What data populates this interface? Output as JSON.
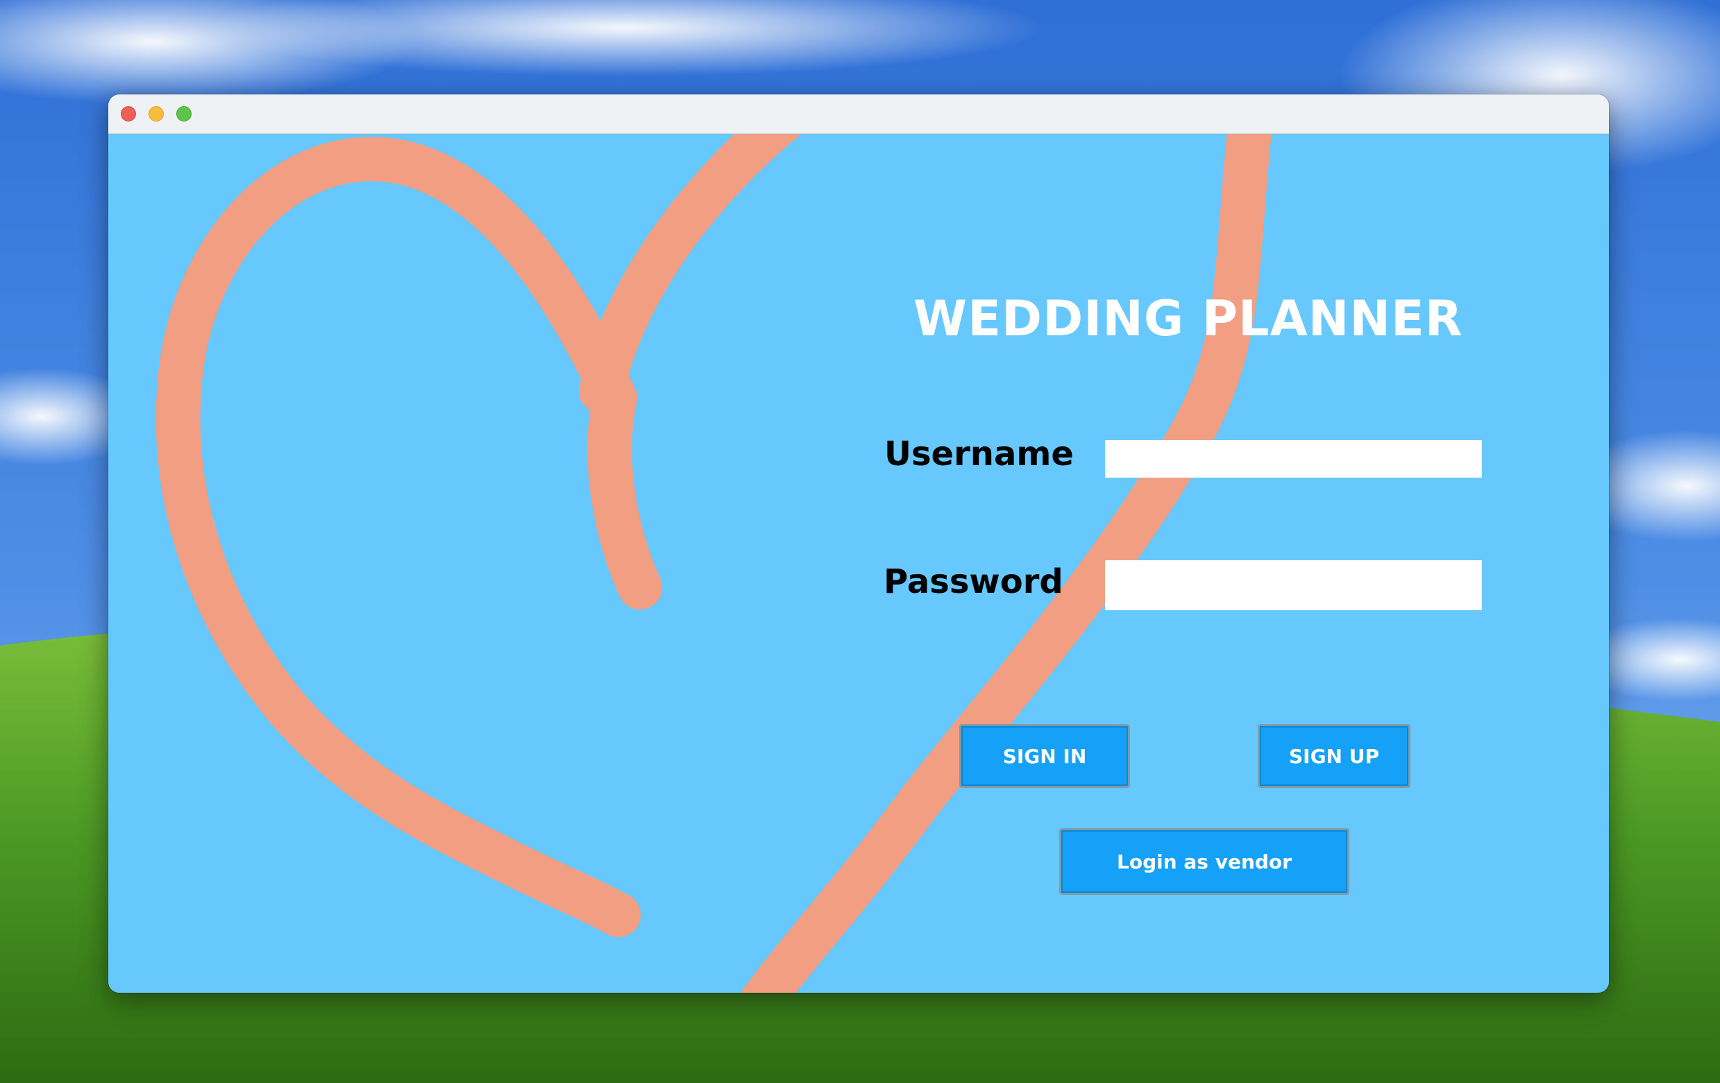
{
  "window": {
    "controls": {
      "close_color": "#ee5f57",
      "minimize_color": "#f6bd3b",
      "zoom_color": "#5fc54a"
    }
  },
  "app": {
    "title": "WEDDING PLANNER",
    "background_color": "#66c8fc",
    "decoration_color": "#f29e83",
    "decoration_icon": "heart-outline"
  },
  "form": {
    "username_label": "Username",
    "username_value": "",
    "password_label": "Password",
    "password_value": ""
  },
  "buttons": {
    "sign_in": "SIGN IN",
    "sign_up": "SIGN UP",
    "vendor_login": "Login as vendor",
    "color": "#14a1f7"
  }
}
